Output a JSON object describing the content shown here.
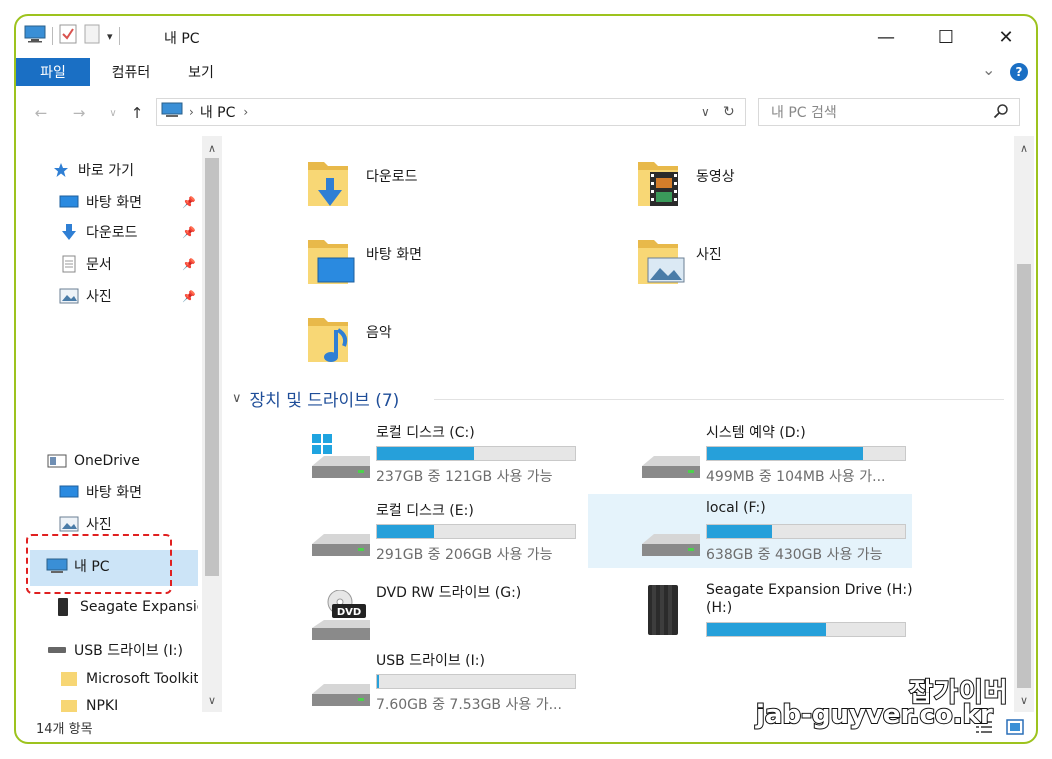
{
  "window": {
    "title": "내 PC",
    "minimize_glyph": "—",
    "maximize_glyph": "☐",
    "close_glyph": "✕"
  },
  "ribbon": {
    "tabs": [
      "파일",
      "컴퓨터",
      "보기"
    ],
    "expand_glyph": "⌄",
    "help_glyph": "?"
  },
  "address": {
    "breadcrumb": [
      "내 PC"
    ],
    "search_placeholder": "내 PC 검색"
  },
  "nav": {
    "quick_access": "바로 가기",
    "quick_items": [
      "바탕 화면",
      "다운로드",
      "문서",
      "사진"
    ],
    "onedrive": "OneDrive",
    "onedrive_items": [
      "바탕 화면",
      "사진"
    ],
    "this_pc": "내 PC",
    "seagate": "Seagate Expansion Drive (H:)",
    "usb": "USB 드라이브 (I:)",
    "ms_toolkit": "Microsoft Toolkit",
    "npki": "NPKI"
  },
  "folders": [
    "다운로드",
    "동영상",
    "바탕 화면",
    "사진",
    "음악"
  ],
  "devices_section": {
    "label": "장치 및 드라이브 (7)"
  },
  "drives": [
    {
      "name": "로컬 디스크 (C:)",
      "info": "237GB 중 121GB 사용 가능",
      "used_fraction": 0.49
    },
    {
      "name": "시스템 예약 (D:)",
      "info": "499MB 중 104MB 사용 가...",
      "used_fraction": 0.79
    },
    {
      "name": "로컬 디스크 (E:)",
      "info": "291GB 중 206GB 사용 가능",
      "used_fraction": 0.29
    },
    {
      "name": "local (F:)",
      "info": "638GB 중 430GB 사용 가능",
      "used_fraction": 0.33
    },
    {
      "name": "DVD RW 드라이브 (G:)",
      "info": "",
      "used_fraction": null
    },
    {
      "name": "Seagate Expansion Drive (H:)",
      "info": "",
      "used_fraction": 0.6
    },
    {
      "name": "USB 드라이브 (I:)",
      "info": "7.60GB 중 7.53GB 사용 가...",
      "used_fraction": 0.01
    }
  ],
  "status": {
    "item_count": "14개 항목"
  },
  "watermark": {
    "line1": "잡가이버",
    "line2": "jab-guyver.co.kr"
  },
  "colors": {
    "accent": "#1a6fc4",
    "bar_fill": "#26a0da",
    "section_text": "#1f4e99",
    "frame": "#9dc31e",
    "highlight": "#e02020"
  }
}
